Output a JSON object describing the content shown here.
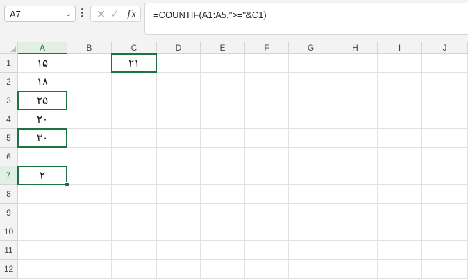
{
  "name_box": {
    "value": "A7"
  },
  "formula_bar": {
    "cancel_icon": "✕",
    "enter_icon": "✓",
    "fx_label": "fx",
    "formula": "=COUNTIF(A1:A5,\">=\"&C1)"
  },
  "columns": [
    "A",
    "B",
    "C",
    "D",
    "E",
    "F",
    "G",
    "H",
    "I",
    "J"
  ],
  "rows": [
    "1",
    "2",
    "3",
    "4",
    "5",
    "6",
    "7",
    "8",
    "9",
    "10",
    "11",
    "12"
  ],
  "cells": {
    "A1": "۱۵",
    "A2": "۱۸",
    "A3": "۲۵",
    "A4": "۲۰",
    "A5": "۳۰",
    "A7": "۲",
    "C1": "۲۱"
  },
  "colors": {
    "accent": "#1e7145",
    "grid": "#e1e1e1",
    "header_bg": "#f3f3f3"
  }
}
